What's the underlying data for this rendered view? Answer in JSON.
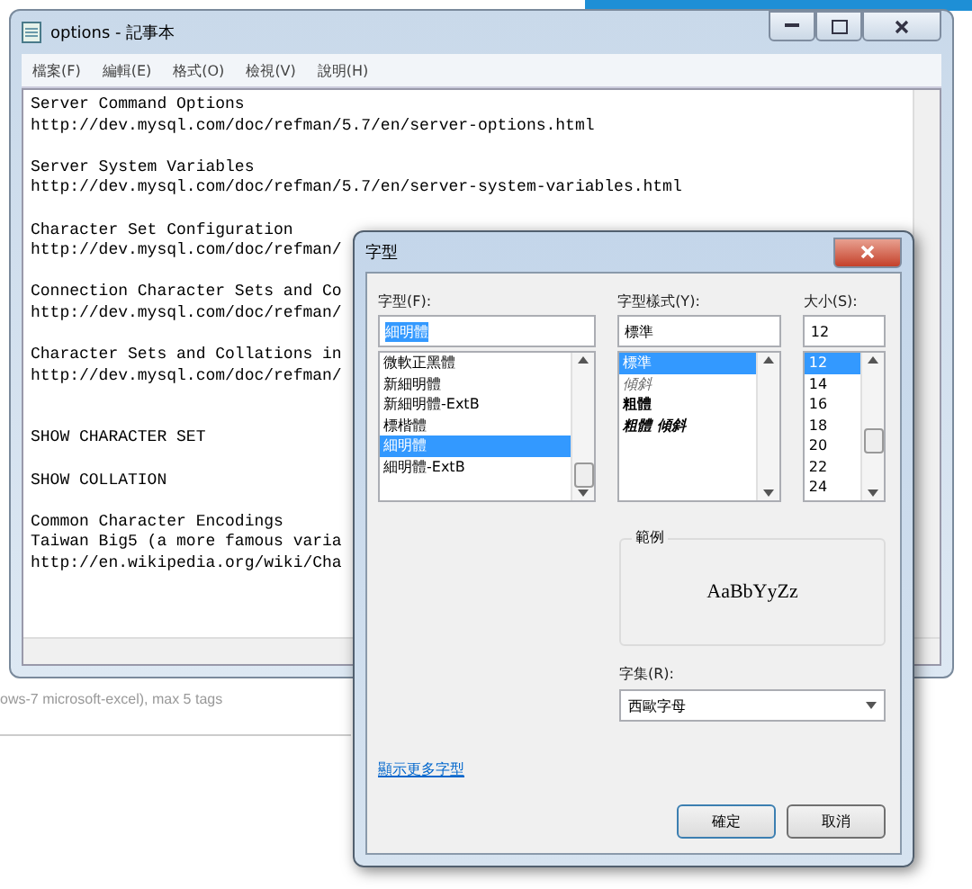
{
  "background": {
    "status_text": "ows-7 microsoft-excel), max 5 tags"
  },
  "notepad": {
    "title": "options - 記事本",
    "menu": [
      "檔案(F)",
      "編輯(E)",
      "格式(O)",
      "檢視(V)",
      "說明(H)"
    ],
    "paragraphs": [
      [
        "Server Command Options",
        "http://dev.mysql.com/doc/refman/5.7/en/server-options.html"
      ],
      [
        "Server System Variables",
        "http://dev.mysql.com/doc/refman/5.7/en/server-system-variables.html"
      ],
      [
        "Character Set Configuration",
        "http://dev.mysql.com/doc/refman/"
      ],
      [
        "Connection Character Sets and Co",
        "http://dev.mysql.com/doc/refman/"
      ],
      [
        "Character Sets and Collations in",
        "http://dev.mysql.com/doc/refman/"
      ],
      [
        "SHOW CHARACTER SET"
      ],
      [
        "SHOW COLLATION"
      ],
      [
        "Common Character Encodings",
        "Taiwan Big5 (a more famous varia",
        "http://en.wikipedia.org/wiki/Cha"
      ]
    ]
  },
  "font_dialog": {
    "title": "字型",
    "font": {
      "label": "字型(F):",
      "value": "細明體",
      "items": [
        {
          "text": "微軟正黑體",
          "selected": false
        },
        {
          "text": "新細明體",
          "selected": false
        },
        {
          "text": "新細明體-ExtB",
          "selected": false
        },
        {
          "text": "標楷體",
          "selected": false
        },
        {
          "text": "細明體",
          "selected": true
        },
        {
          "text": "細明體-ExtB",
          "selected": false
        }
      ]
    },
    "style": {
      "label": "字型樣式(Y):",
      "value": "標準",
      "items": [
        {
          "text": "標準",
          "selected": true,
          "kind": "regular"
        },
        {
          "text": "傾斜",
          "selected": false,
          "kind": "italic"
        },
        {
          "text": "粗體",
          "selected": false,
          "kind": "bold"
        },
        {
          "text": "粗體 傾斜",
          "selected": false,
          "kind": "bolditalic"
        }
      ]
    },
    "size": {
      "label": "大小(S):",
      "value": "12",
      "items": [
        {
          "text": "12",
          "selected": true
        },
        {
          "text": "14",
          "selected": false
        },
        {
          "text": "16",
          "selected": false
        },
        {
          "text": "18",
          "selected": false
        },
        {
          "text": "20",
          "selected": false
        },
        {
          "text": "22",
          "selected": false
        },
        {
          "text": "24",
          "selected": false
        }
      ]
    },
    "sample": {
      "label": "範例",
      "text": "AaBbYyZz"
    },
    "script": {
      "label": "字集(R):",
      "value": "西歐字母"
    },
    "more_fonts_link": "顯示更多字型",
    "buttons": [
      "確定",
      "取消"
    ]
  }
}
